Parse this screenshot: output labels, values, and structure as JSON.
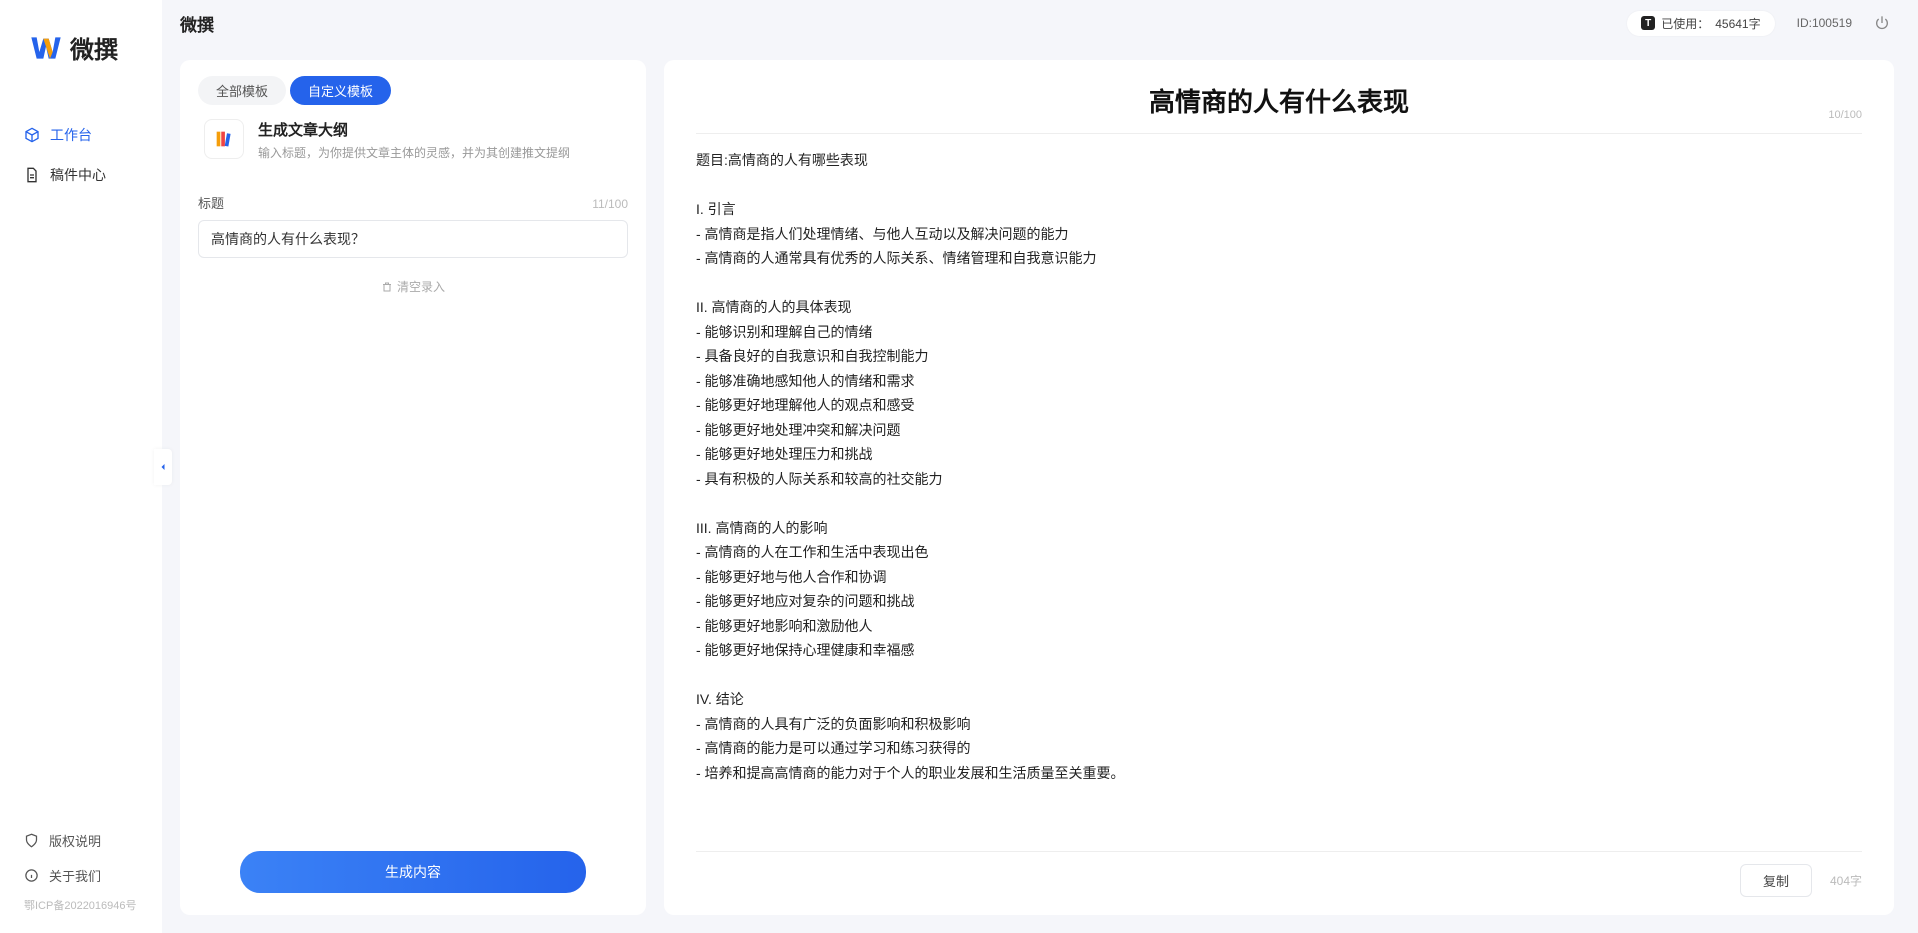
{
  "app": {
    "logo_text": "微撰",
    "title": "微撰"
  },
  "sidebar": {
    "nav": [
      {
        "label": "工作台",
        "icon": "cube-icon",
        "active": true
      },
      {
        "label": "稿件中心",
        "icon": "document-icon",
        "active": false
      }
    ],
    "bottom": [
      {
        "label": "版权说明",
        "icon": "shield-icon"
      },
      {
        "label": "关于我们",
        "icon": "info-icon"
      }
    ],
    "icp": "鄂ICP备2022016946号"
  },
  "topbar": {
    "usage_prefix": "已使用：",
    "usage_value": "45641字",
    "id_prefix": "ID:",
    "user_id": "100519"
  },
  "left_panel": {
    "tabs": [
      {
        "label": "全部模板",
        "active": false
      },
      {
        "label": "自定义模板",
        "active": true
      }
    ],
    "template": {
      "title": "生成文章大纲",
      "desc": "输入标题，为你提供文章主体的灵感，并为其创建推文提纲"
    },
    "field_label": "标题",
    "field_counter": "11/100",
    "input_value": "高情商的人有什么表现？",
    "clear_label": "清空录入",
    "generate_label": "生成内容"
  },
  "right_panel": {
    "title": "高情商的人有什么表现",
    "title_counter": "10/100",
    "body": "题目:高情商的人有哪些表现\n\nI. 引言\n- 高情商是指人们处理情绪、与他人互动以及解决问题的能力\n- 高情商的人通常具有优秀的人际关系、情绪管理和自我意识能力\n\nII. 高情商的人的具体表现\n- 能够识别和理解自己的情绪\n- 具备良好的自我意识和自我控制能力\n- 能够准确地感知他人的情绪和需求\n- 能够更好地理解他人的观点和感受\n- 能够更好地处理冲突和解决问题\n- 能够更好地处理压力和挑战\n- 具有积极的人际关系和较高的社交能力\n\nIII. 高情商的人的影响\n- 高情商的人在工作和生活中表现出色\n- 能够更好地与他人合作和协调\n- 能够更好地应对复杂的问题和挑战\n- 能够更好地影响和激励他人\n- 能够更好地保持心理健康和幸福感\n\nIV. 结论\n- 高情商的人具有广泛的负面影响和积极影响\n- 高情商的能力是可以通过学习和练习获得的\n- 培养和提高高情商的能力对于个人的职业发展和生活质量至关重要。",
    "copy_label": "复制",
    "word_count": "404字"
  }
}
